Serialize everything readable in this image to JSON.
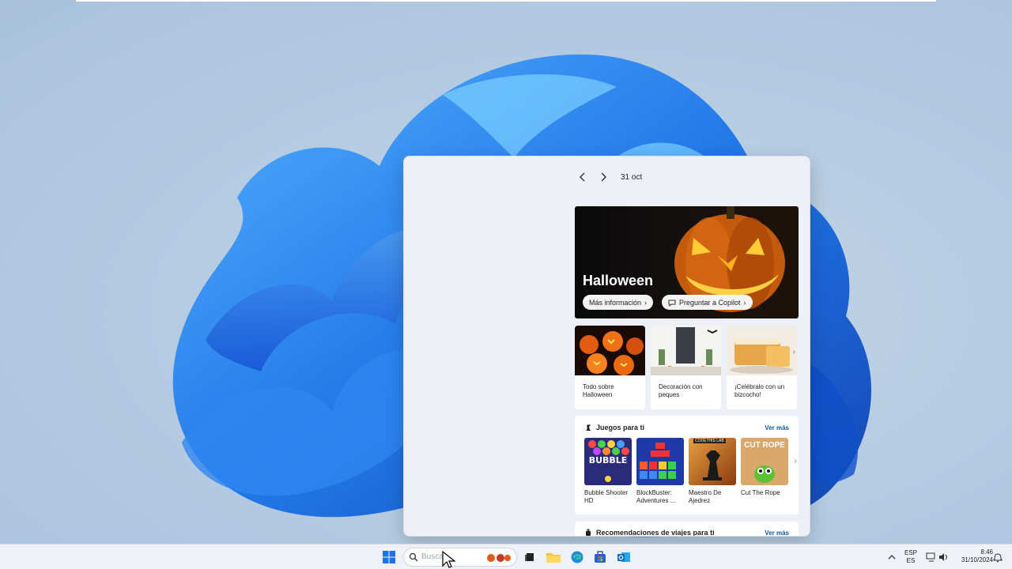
{
  "flyout": {
    "nav_date": "31 oct",
    "hero": {
      "title": "Halloween",
      "more_info": "Más información",
      "ask_copilot": "Preguntar a Copilot"
    },
    "cards": [
      {
        "label": "Todo sobre Halloween"
      },
      {
        "label": "Decoración con peques"
      },
      {
        "label": "¡Celébralo con un bizcocho!"
      }
    ],
    "games": {
      "title": "Juegos para ti",
      "more": "Ver más",
      "items": [
        {
          "name": "Bubble Shooter HD",
          "art_text": "BUBBLE"
        },
        {
          "name": "BlockBuster: Adventures ...",
          "art_text": ""
        },
        {
          "name": "Maestro De Ajedrez",
          "art_text": "CODETHIS LAB"
        },
        {
          "name": "Cut The Rope",
          "art_text": "CUT ROPE"
        }
      ]
    },
    "travel": {
      "title": "Recomendaciones de viajes para ti",
      "more": "Ver más"
    }
  },
  "taskbar": {
    "search_placeholder": "Buscar",
    "lang_top": "ESP",
    "lang_bottom": "ES",
    "time": "8:46",
    "date": "31/10/2024"
  },
  "colors": {
    "accent": "#0a5bb5",
    "wallpaper_blue": "#1b6fe0"
  }
}
